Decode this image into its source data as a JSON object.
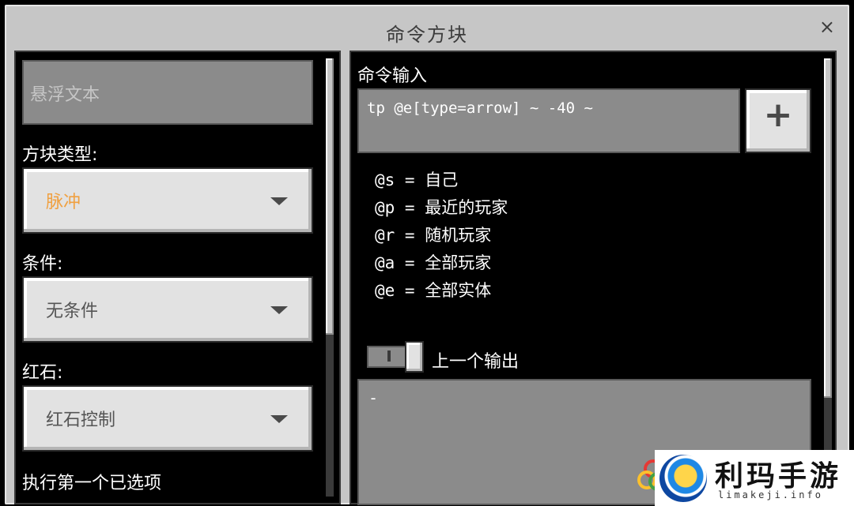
{
  "window": {
    "title": "命令方块",
    "close_symbol": "×"
  },
  "left_panel": {
    "hover_text_placeholder": "悬浮文本",
    "block_type": {
      "label": "方块类型:",
      "value": "脉冲",
      "value_color": "#f0a040"
    },
    "condition": {
      "label": "条件:",
      "value": "无条件"
    },
    "redstone": {
      "label": "红石:",
      "value": "红石控制"
    },
    "execute_first_label": "执行第一个已选项"
  },
  "right_panel": {
    "command_input": {
      "label": "命令输入",
      "value": "tp @e[type=arrow] ~ -40 ~"
    },
    "add_button_symbol": "+",
    "selectors": [
      "@s = 自己",
      "@p = 最近的玩家",
      "@r = 随机玩家",
      "@a = 全部玩家",
      "@e = 全部实体"
    ],
    "previous_output": {
      "label": "上一个输出",
      "value": "-"
    }
  },
  "watermark": {
    "main": "利玛手游",
    "sub": "limakeji.info"
  }
}
